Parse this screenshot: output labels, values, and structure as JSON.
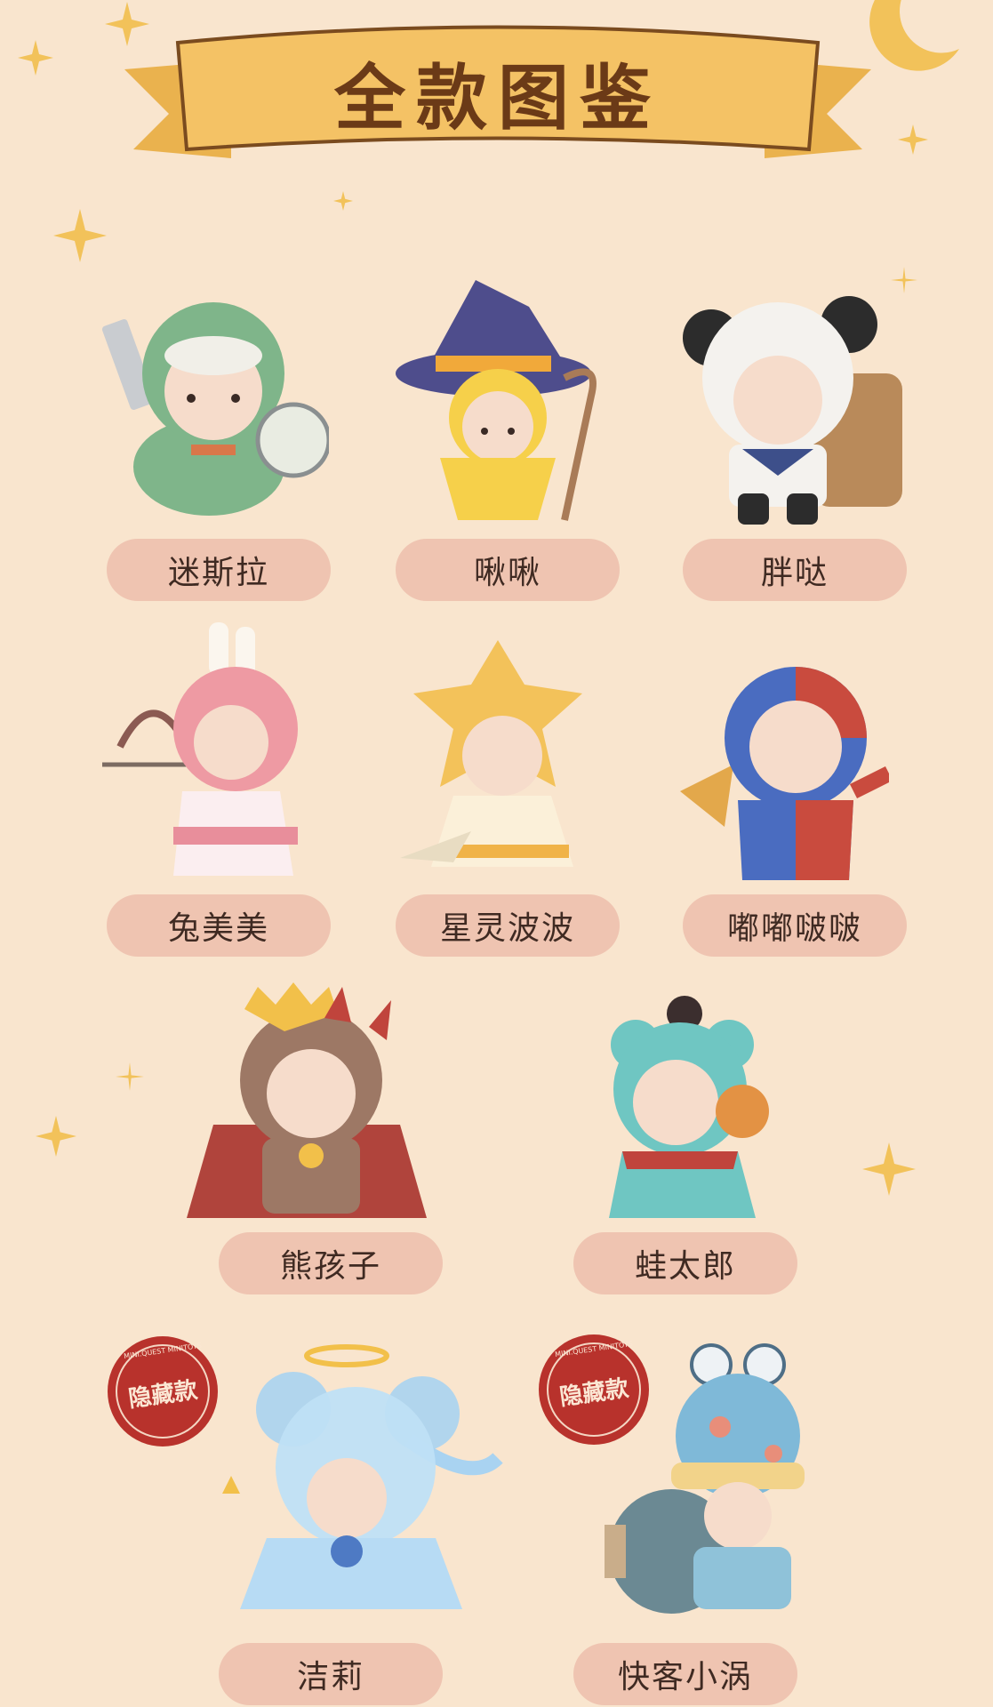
{
  "header": {
    "title": "全款图鉴"
  },
  "characters": [
    {
      "name": "迷斯拉"
    },
    {
      "name": "啾啾"
    },
    {
      "name": "胖哒"
    },
    {
      "name": "兔美美"
    },
    {
      "name": "星灵波波"
    },
    {
      "name": "嘟嘟啵啵"
    },
    {
      "name": "熊孩子"
    },
    {
      "name": "蛙太郎"
    },
    {
      "name": "洁莉",
      "hidden_badge": {
        "text": "隐藏款",
        "brand": "MINI.QUEST MINITOYS"
      }
    },
    {
      "name": "快客小涡",
      "hidden_badge": {
        "text": "隐藏款",
        "brand": "MINI.QUEST MINITOYS"
      }
    }
  ],
  "colors": {
    "background": "#f9e5ce",
    "banner": "#f4c265",
    "banner_title": "#6b3a17",
    "label_bg": "#efc4b1",
    "star": "#f2c25a",
    "seal": "#b8322c"
  },
  "icons": [
    "moon-icon",
    "star-icon",
    "sparkle-icon"
  ]
}
